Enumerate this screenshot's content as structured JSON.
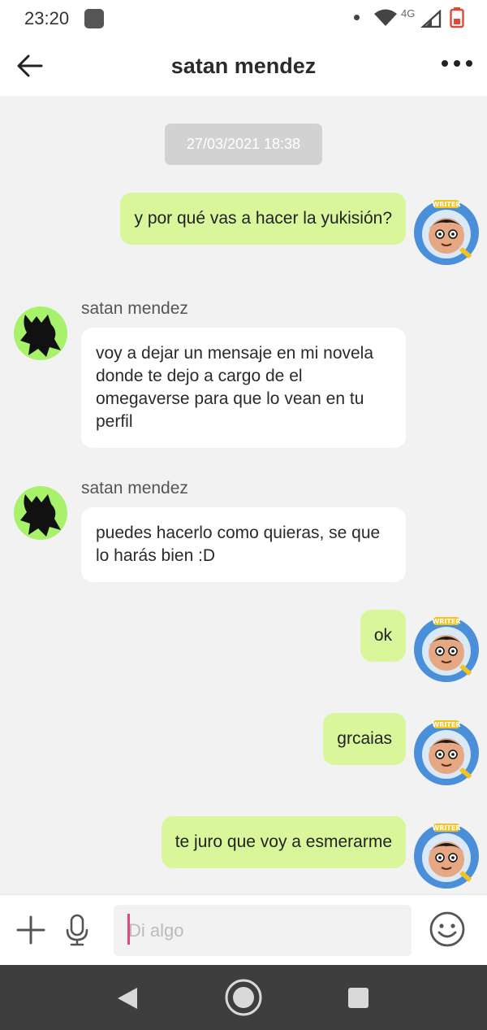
{
  "status_bar": {
    "time": "23:20",
    "network": "4G",
    "icons": [
      "app-notification-icon",
      "dot-icon",
      "wifi-icon",
      "signal-icon",
      "battery-icon"
    ]
  },
  "header": {
    "title": "satan mendez",
    "back_icon": "arrow-left-icon",
    "menu_icon": "more-dots-icon"
  },
  "chat": {
    "date": "27/03/2021 18:38",
    "messages": [
      {
        "direction": "out",
        "text": "y por qué vas a hacer la yukisión?"
      },
      {
        "direction": "in",
        "sender": "satan mendez",
        "text": "voy a dejar un mensaje en mi novela donde te dejo a cargo de el omegaverse para que lo vean en tu perfil"
      },
      {
        "direction": "in",
        "sender": "satan mendez",
        "text": "puedes hacerlo como quieras, se que lo harás bien :D"
      },
      {
        "direction": "out",
        "text": "ok"
      },
      {
        "direction": "out",
        "text": "grcaias"
      },
      {
        "direction": "out",
        "text": "te juro que voy a esmerarme"
      }
    ],
    "self_avatar_badge": "WRITER"
  },
  "input": {
    "placeholder": "Di algo",
    "value": ""
  },
  "colors": {
    "outgoing_bubble": "#d9f79a",
    "incoming_bubble": "#ffffff",
    "background": "#f2f2f2",
    "other_avatar_bg": "#a7f26a",
    "caret": "#e0487a"
  }
}
